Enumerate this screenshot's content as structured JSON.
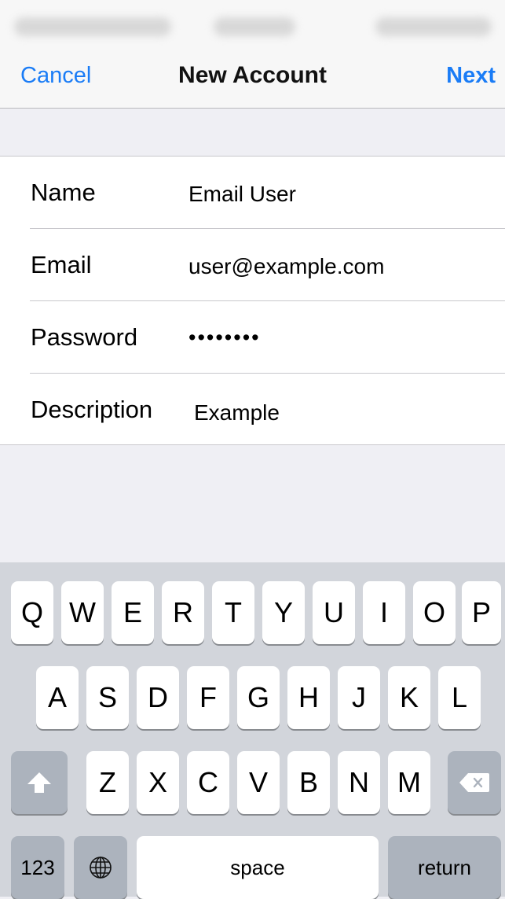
{
  "nav": {
    "cancel": "Cancel",
    "title": "New Account",
    "next": "Next"
  },
  "form": {
    "fields": [
      {
        "label": "Name",
        "value": "Email User"
      },
      {
        "label": "Email",
        "value": "user@example.com"
      },
      {
        "label": "Password",
        "value": "••••••••"
      },
      {
        "label": "Description",
        "value": "Example"
      }
    ]
  },
  "keyboard": {
    "row1": [
      "Q",
      "W",
      "E",
      "R",
      "T",
      "Y",
      "U",
      "I",
      "O",
      "P"
    ],
    "row2": [
      "A",
      "S",
      "D",
      "F",
      "G",
      "H",
      "J",
      "K",
      "L"
    ],
    "row3": [
      "Z",
      "X",
      "C",
      "V",
      "B",
      "N",
      "M"
    ],
    "numbers": "123",
    "space": "space",
    "return": "return",
    "icons": {
      "shift": "shift-icon",
      "delete": "delete-icon",
      "globe": "globe-icon"
    }
  },
  "colors": {
    "accent": "#1a7cf6",
    "background": "#efeff4",
    "keyboard": "#d2d5db"
  }
}
